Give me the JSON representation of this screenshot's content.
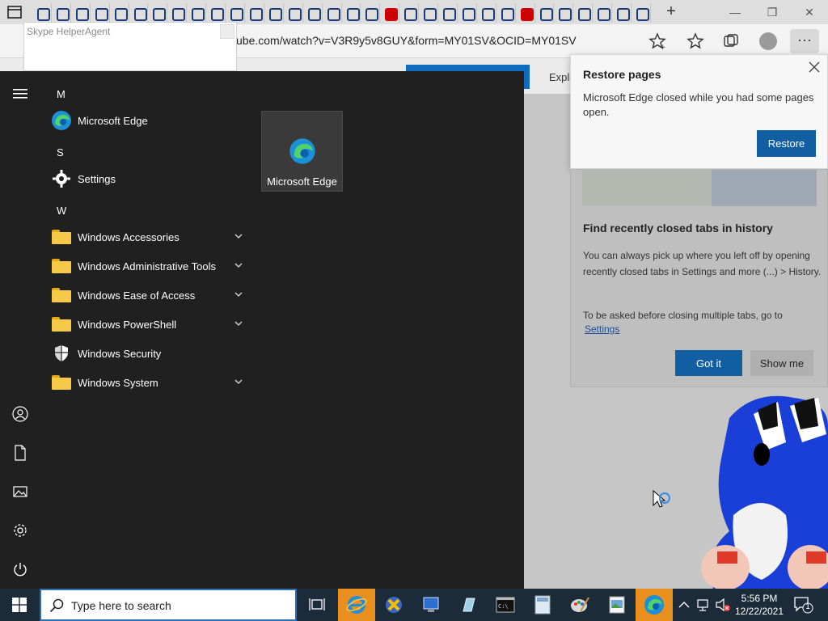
{
  "browser": {
    "url": "ube.com/watch?v=V3R9y5v8GUY&form=MY01SV&OCID=MY01SV",
    "new_tab_symbol": "+",
    "minimize_symbol": "—",
    "restore_symbol": "❐",
    "close_symbol": "✕",
    "more_symbol": "···",
    "explore_label": "Explo"
  },
  "skype_helper": {
    "title": "Skype HelperAgent"
  },
  "start_menu": {
    "groups": [
      {
        "letter": "M",
        "apps": [
          {
            "label": "Microsoft Edge",
            "icon": "edge-icon"
          }
        ]
      },
      {
        "letter": "S",
        "apps": [
          {
            "label": "Settings",
            "icon": "gear-icon"
          }
        ]
      },
      {
        "letter": "W",
        "apps": [
          {
            "label": "Windows Accessories",
            "icon": "folder-icon",
            "expandable": true
          },
          {
            "label": "Windows Administrative Tools",
            "icon": "folder-icon",
            "expandable": true
          },
          {
            "label": "Windows Ease of Access",
            "icon": "folder-icon",
            "expandable": true
          },
          {
            "label": "Windows PowerShell",
            "icon": "folder-icon",
            "expandable": true
          },
          {
            "label": "Windows Security",
            "icon": "shield-icon",
            "expandable": false
          },
          {
            "label": "Windows System",
            "icon": "folder-icon",
            "expandable": true
          }
        ]
      }
    ],
    "tile": {
      "label": "Microsoft Edge",
      "icon": "edge-icon"
    }
  },
  "restore_popup": {
    "title": "Restore pages",
    "message": "Microsoft Edge closed while you had some pages open.",
    "button": "Restore"
  },
  "tip_card": {
    "title": "Find recently closed tabs in history",
    "text1": "You can always pick up where you left off by opening recently closed tabs in Settings and more (...) > History.",
    "text2": "To be asked before closing multiple tabs, go to",
    "link": "Settings",
    "primary_button": "Got it",
    "secondary_button": "Show me"
  },
  "taskbar": {
    "search_placeholder": "Type here to search",
    "time": "5:56 PM",
    "date": "12/22/2021",
    "notification_count": "1"
  },
  "colors": {
    "start_bg": "#202020",
    "taskbar_bg": "#1c2b3a",
    "accent": "#115ea3",
    "active_app": "#e88f1e"
  }
}
